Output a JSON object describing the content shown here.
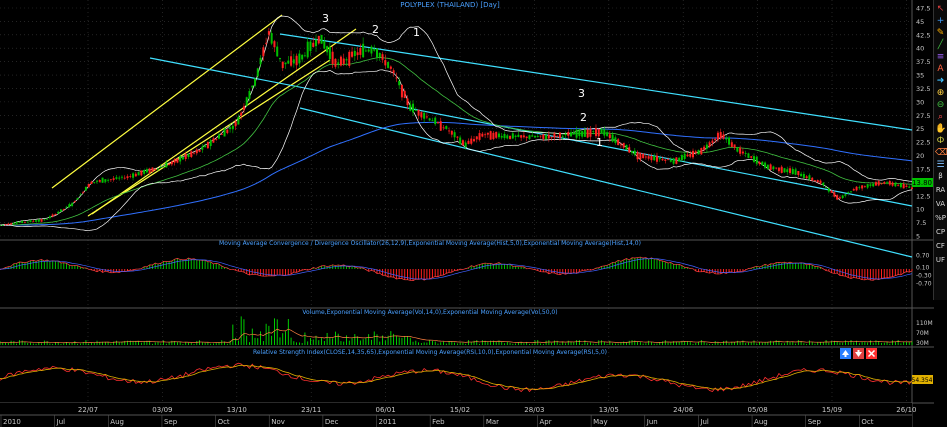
{
  "window_title": "POLYPLEX (THAILAND) [Day]",
  "colors": {
    "background": "#000000",
    "price_up": "#00c000",
    "price_down": "#ff2020",
    "channel_up": "#ffff40",
    "channel_down": "#40e0ff",
    "ema_long": "#3070ff",
    "bollinger": "#ffffff",
    "macd_line": "#ff4040",
    "signal_line": "#4060ff",
    "volume": "#00ff00",
    "rsi": "#ff3030",
    "rsi_ema": "#e0b000",
    "grid": "#3a3a3a",
    "axis_text": "#c8c8c8"
  },
  "panels": {
    "macd": {
      "title": "Moving Average Convergence / Divergence Oscillator(26,12,9),Exponential Moving Average(Hist,5,0),Exponential Moving Average(Hist,14,0)"
    },
    "volume": {
      "title": "Volume,Exponential Moving Average(Vol,14,0),Exponential Moving Average(Vol,50,0)"
    },
    "rsi": {
      "title": "Relative Strength Index(CLOSE,14,35,65),Exponential Moving Average(RSI,10,0),Exponential Moving Average(RSI,5,0)"
    }
  },
  "annotations": {
    "up_wave": [
      "3",
      "2",
      "1"
    ],
    "down_wave": [
      "3",
      "2",
      "1"
    ]
  },
  "current_price": "13.80",
  "current_rsi": "54.354",
  "toolbar": {
    "items": [
      {
        "icon": "cursor-icon"
      },
      {
        "icon": "crosshair-icon"
      },
      {
        "icon": "pencil-icon"
      },
      {
        "icon": "line-icon"
      },
      {
        "icon": "channel-icon"
      },
      {
        "icon": "text-icon"
      },
      {
        "icon": "arrow-icon"
      },
      {
        "icon": "zoom-in-icon"
      },
      {
        "icon": "zoom-out-icon"
      },
      {
        "icon": "magnifier-icon"
      },
      {
        "icon": "hand-icon"
      },
      {
        "icon": "fibonacci-icon"
      },
      {
        "icon": "eraser-icon"
      },
      {
        "icon": "properties-icon"
      }
    ],
    "labels": [
      "β",
      "RA",
      "VA",
      "%P",
      "CP",
      "CF",
      "UF"
    ]
  },
  "panel_buttons": [
    "move-up-icon",
    "move-down-icon",
    "close-icon"
  ],
  "chart_data": {
    "type": "candlestick",
    "title": "POLYPLEX (THAILAND) [Day]",
    "y_axis": {
      "min": 5,
      "max": 47.5,
      "ticks": [
        "47.5",
        "45",
        "42.5",
        "40",
        "37.5",
        "35",
        "32.5",
        "30",
        "27.5",
        "25",
        "22.5",
        "20",
        "17.5",
        "15",
        "12.5",
        "10",
        "7.5",
        "5"
      ]
    },
    "x_axis_dates": [
      "22/07",
      "03/09",
      "13/10",
      "23/11",
      "06/01",
      "15/02",
      "28/03",
      "13/05",
      "24/06",
      "05/08",
      "15/09",
      "26/10"
    ],
    "x_axis_months": [
      "2010",
      "Jul",
      "Aug",
      "Sep",
      "Oct",
      "Nov",
      "Dec",
      "2011",
      "Feb",
      "Mar",
      "Apr",
      "May",
      "Jun",
      "Jul",
      "Aug",
      "Sep",
      "Oct"
    ],
    "price_path": [
      [
        0,
        7
      ],
      [
        0.02,
        7.5
      ],
      [
        0.05,
        8
      ],
      [
        0.08,
        11
      ],
      [
        0.1,
        15
      ],
      [
        0.14,
        16
      ],
      [
        0.18,
        18
      ],
      [
        0.22,
        21
      ],
      [
        0.26,
        26
      ],
      [
        0.28,
        34
      ],
      [
        0.295,
        43
      ],
      [
        0.31,
        37
      ],
      [
        0.33,
        38
      ],
      [
        0.35,
        42
      ],
      [
        0.37,
        37
      ],
      [
        0.39,
        39
      ],
      [
        0.41,
        40
      ],
      [
        0.43,
        36
      ],
      [
        0.45,
        29
      ],
      [
        0.47,
        27
      ],
      [
        0.49,
        25
      ],
      [
        0.51,
        22
      ],
      [
        0.53,
        24
      ],
      [
        0.56,
        23.5
      ],
      [
        0.6,
        23.5
      ],
      [
        0.63,
        24
      ],
      [
        0.66,
        24.5
      ],
      [
        0.7,
        20
      ],
      [
        0.74,
        19
      ],
      [
        0.77,
        21
      ],
      [
        0.79,
        24
      ],
      [
        0.81,
        21
      ],
      [
        0.84,
        18
      ],
      [
        0.87,
        17
      ],
      [
        0.9,
        15
      ],
      [
        0.92,
        12
      ],
      [
        0.94,
        14
      ],
      [
        0.97,
        15
      ],
      [
        1,
        14
      ]
    ],
    "macd_ticks": [
      "0.70",
      "0.10",
      "-0.30",
      "-0.70"
    ],
    "volume_ticks": [
      "110M",
      "70M",
      "30M"
    ],
    "rsi_ticks": [
      "54.354"
    ]
  }
}
